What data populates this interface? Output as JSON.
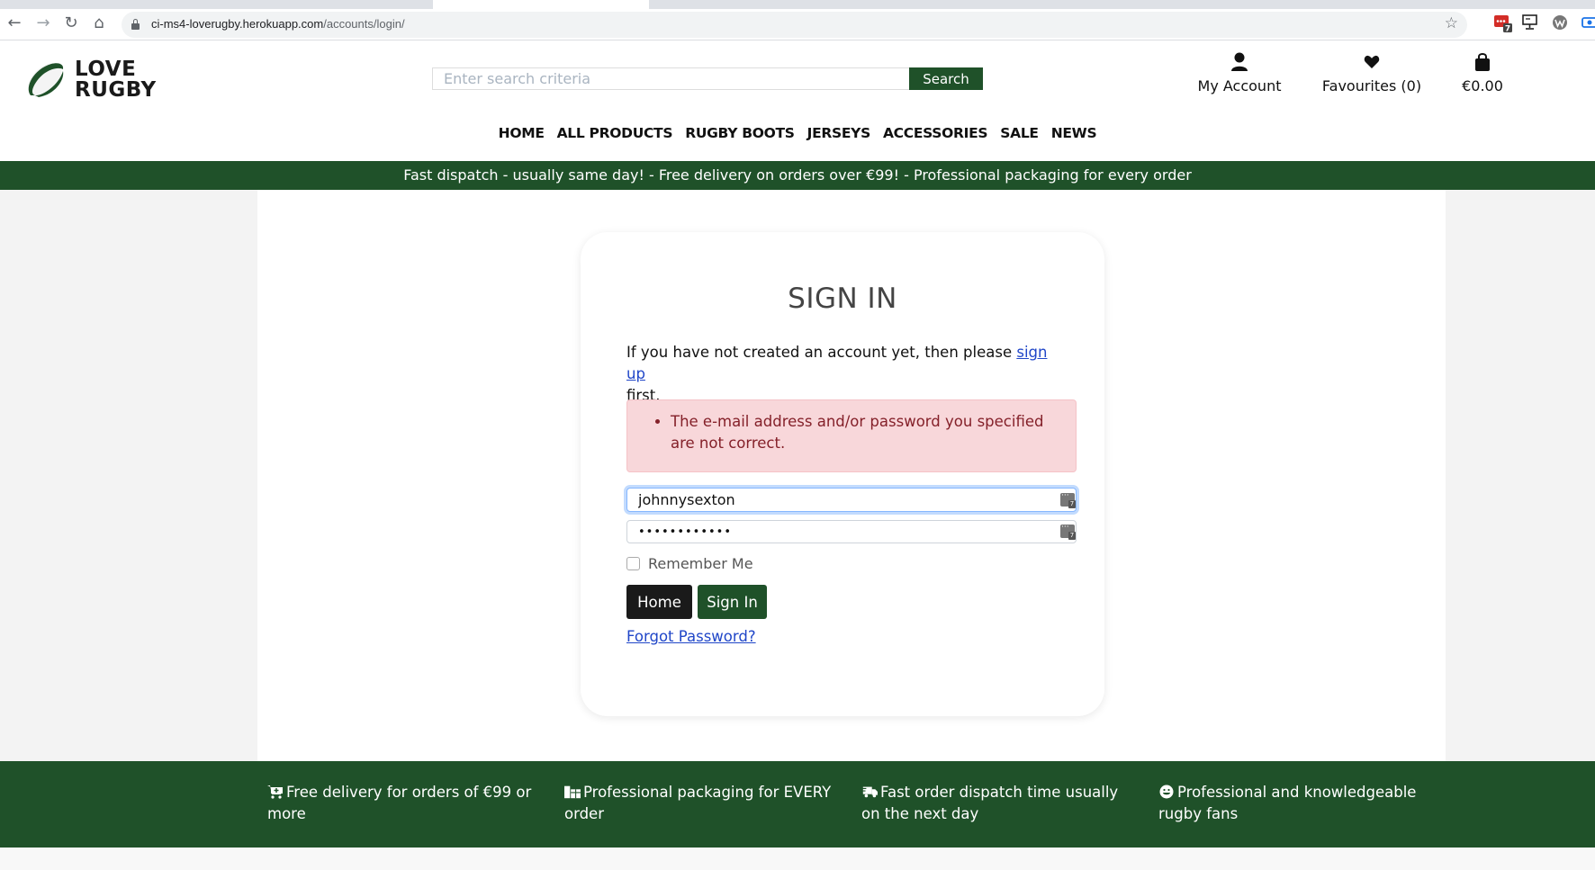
{
  "browser": {
    "url_host": "ci-ms4-loverugby.herokuapp.com",
    "url_path": "/accounts/login/",
    "extensions": [
      {
        "name": "lastpass-extension",
        "badge": "7"
      },
      {
        "name": "screen-extension"
      },
      {
        "name": "wordpress-extension"
      },
      {
        "name": "screencast-extension"
      }
    ]
  },
  "header": {
    "logo_line1": "LOVE",
    "logo_line2": "RUGBY",
    "search_placeholder": "Enter search criteria",
    "search_value": "",
    "search_button": "Search",
    "account_label": "My Account",
    "favourites_label": "Favourites (0)",
    "bag_total": "€0.00"
  },
  "nav": {
    "items": [
      "HOME",
      "ALL PRODUCTS",
      "RUGBY BOOTS",
      "JERSEYS",
      "ACCESSORIES",
      "SALE",
      "NEWS"
    ]
  },
  "banner": {
    "text": "Fast dispatch - usually same day! - Free delivery on orders over €99! - Professional packaging for every order"
  },
  "signin": {
    "title": "SIGN IN",
    "intro_before": "If you have not created an account yet, then please ",
    "signup_link": "sign up",
    "intro_after": " first.",
    "error": "The e-mail address and/or password you specified are not correct.",
    "username_value": "johnnysexton",
    "password_value": "••••••••••••",
    "remember_label": "Remember Me",
    "remember_checked": false,
    "home_button": "Home",
    "signin_button": "Sign In",
    "forgot_link": "Forgot Password?"
  },
  "footer": {
    "items": [
      {
        "icon": "cart-plus-icon",
        "text": "Free delivery for orders of €99 or more"
      },
      {
        "icon": "gift-box-icon",
        "text": "Professional packaging for EVERY order"
      },
      {
        "icon": "shipping-truck-icon",
        "text": "Fast order dispatch time usually on the next day"
      },
      {
        "icon": "smile-icon",
        "text": "Professional and knowledgeable rugby fans"
      }
    ]
  },
  "colors": {
    "brand_green": "#1f5129",
    "link_blue": "#2046c8",
    "alert_bg": "#f8d7da",
    "alert_text": "#842029"
  }
}
